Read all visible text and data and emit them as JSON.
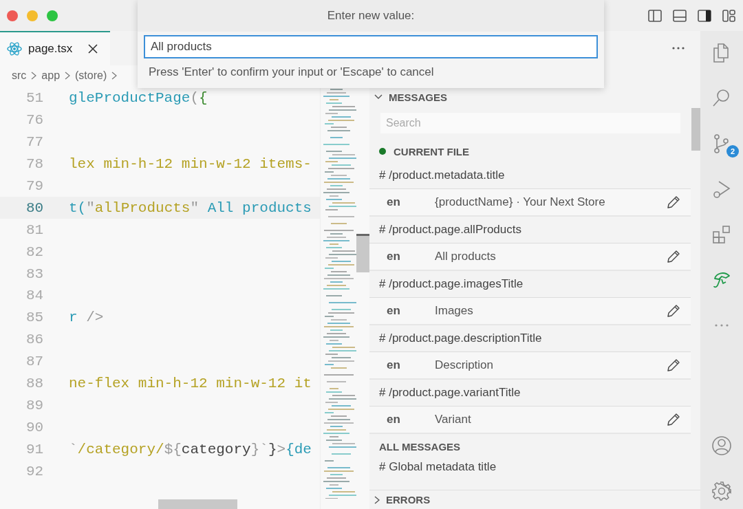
{
  "tabs": [
    {
      "label": "page.tsx",
      "selected": true
    }
  ],
  "breadcrumb": [
    "src",
    "app",
    "(store)"
  ],
  "editor": {
    "lines": [
      {
        "number": "51",
        "current": false,
        "tokens": [
          {
            "text": "gleProductPage",
            "kind": "fn"
          },
          {
            "text": "(",
            "kind": "punct"
          },
          {
            "text": "{",
            "kind": "brace"
          }
        ]
      },
      {
        "number": "76",
        "current": false
      },
      {
        "number": "77",
        "current": false
      },
      {
        "number": "78",
        "current": false,
        "tokens": [
          {
            "text": "lex min-h-12 min-w-12 items-",
            "kind": "str"
          }
        ]
      },
      {
        "number": "79",
        "current": false
      },
      {
        "number": "80",
        "current": true,
        "tokens": [
          {
            "text": "t(",
            "kind": "fn"
          },
          {
            "text": "\"",
            "kind": "punct"
          },
          {
            "text": "allProducts",
            "kind": "str"
          },
          {
            "text": "\"",
            "kind": "punct"
          },
          {
            "text": " All products",
            "kind": "fn"
          }
        ]
      },
      {
        "number": "81",
        "current": false
      },
      {
        "number": "82",
        "current": false
      },
      {
        "number": "83",
        "current": false
      },
      {
        "number": "84",
        "current": false
      },
      {
        "number": "85",
        "current": false,
        "tokens": [
          {
            "text": "r ",
            "kind": "fn"
          },
          {
            "text": "/>",
            "kind": "punct"
          }
        ]
      },
      {
        "number": "86",
        "current": false
      },
      {
        "number": "87",
        "current": false
      },
      {
        "number": "88",
        "current": false,
        "tokens": [
          {
            "text": "ne-flex min-h-12 min-w-12 it",
            "kind": "str"
          }
        ]
      },
      {
        "number": "89",
        "current": false
      },
      {
        "number": "90",
        "current": false
      },
      {
        "number": "91",
        "current": false,
        "tokens": [
          {
            "text": "`",
            "kind": "punct"
          },
          {
            "text": "/category/",
            "kind": "str"
          },
          {
            "text": "${",
            "kind": "punct"
          },
          {
            "text": "category",
            "kind": "plain"
          },
          {
            "text": "}`",
            "kind": "punct"
          },
          {
            "text": "}",
            "kind": "plain"
          },
          {
            "text": ">",
            "kind": "punct"
          },
          {
            "text": "{de",
            "kind": "fn"
          }
        ]
      },
      {
        "number": "92",
        "current": false
      }
    ]
  },
  "quick_input": {
    "title": "Enter new value:",
    "value": "All products",
    "help": "Press 'Enter' to confirm your input or 'Escape' to cancel"
  },
  "messages_panel": {
    "title": "MESSAGES",
    "expanded": true,
    "search": {
      "placeholder": "Search"
    },
    "current_file": {
      "title": "CURRENT FILE",
      "entries": [
        {
          "key": "# /product.metadata.title",
          "translations": [
            {
              "locale": "en",
              "value": "{productName} · Your Next Store"
            }
          ]
        },
        {
          "key": "# /product.page.allProducts",
          "translations": [
            {
              "locale": "en",
              "value": "All products"
            }
          ]
        },
        {
          "key": "# /product.page.imagesTitle",
          "translations": [
            {
              "locale": "en",
              "value": "Images"
            }
          ]
        },
        {
          "key": "# /product.page.descriptionTitle",
          "translations": [
            {
              "locale": "en",
              "value": "Description"
            }
          ]
        },
        {
          "key": "# /product.page.variantTitle",
          "translations": [
            {
              "locale": "en",
              "value": "Variant"
            }
          ]
        }
      ]
    },
    "all_messages": {
      "title": "ALL MESSAGES",
      "entries": [
        {
          "key": "# Global metadata title"
        }
      ]
    }
  },
  "errors_panel": {
    "title": "ERRORS",
    "expanded": false
  },
  "activity_bar": [
    {
      "kind": "files",
      "selected": false
    },
    {
      "kind": "search",
      "selected": false
    },
    {
      "kind": "scm",
      "selected": false,
      "badge": "2"
    },
    {
      "kind": "run",
      "selected": false
    },
    {
      "kind": "extensions",
      "selected": false
    },
    {
      "kind": "i18n",
      "selected": true
    },
    {
      "kind": "more",
      "selected": false
    }
  ],
  "activity_bottom": [
    {
      "kind": "account"
    },
    {
      "kind": "settings"
    }
  ]
}
